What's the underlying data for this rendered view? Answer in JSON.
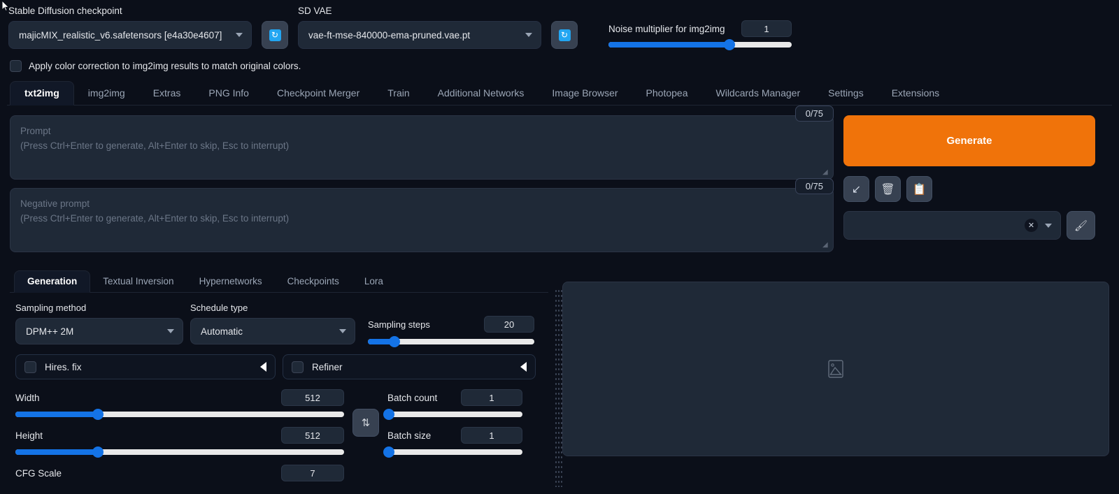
{
  "quicksettings": {
    "checkpoint": {
      "label": "Stable Diffusion checkpoint",
      "value": "majicMIX_realistic_v6.safetensors [e4a30e4607]"
    },
    "vae": {
      "label": "SD VAE",
      "value": "vae-ft-mse-840000-ema-pruned.vae.pt"
    },
    "refresh_icon": "refresh-icon",
    "noise_multiplier": {
      "label": "Noise multiplier for img2img",
      "value": "1",
      "fill_percent": 66
    },
    "color_correction": {
      "label": "Apply color correction to img2img results to match original colors.",
      "checked": false
    }
  },
  "main_tabs": {
    "active": "txt2img",
    "items": [
      "txt2img",
      "img2img",
      "Extras",
      "PNG Info",
      "Checkpoint Merger",
      "Train",
      "Additional Networks",
      "Image Browser",
      "Photopea",
      "Wildcards Manager",
      "Settings",
      "Extensions"
    ]
  },
  "prompt": {
    "positive": {
      "line1": "Prompt",
      "line2": "(Press Ctrl+Enter to generate, Alt+Enter to skip, Esc to interrupt)",
      "value": "",
      "token_counter": "0/75"
    },
    "negative": {
      "line1": "Negative prompt",
      "line2": "(Press Ctrl+Enter to generate, Alt+Enter to skip, Esc to interrupt)",
      "value": "",
      "token_counter": "0/75"
    }
  },
  "actions": {
    "generate_label": "Generate",
    "generate_color": "#f0730a",
    "tools": [
      {
        "name": "restore-progress-icon",
        "glyph": "↙"
      },
      {
        "name": "clear-prompt-icon",
        "glyph": "🗑"
      },
      {
        "name": "paste-styles-icon",
        "glyph": "📋"
      }
    ],
    "styles": {
      "value": "",
      "clear_icon": "close-icon",
      "dropdown_icon": "chevron-down-icon"
    },
    "edit_styles_icon": "paintbrush-icon"
  },
  "sub_tabs": {
    "active": "Generation",
    "items": [
      "Generation",
      "Textual Inversion",
      "Hypernetworks",
      "Checkpoints",
      "Lora"
    ]
  },
  "generation": {
    "sampling_method": {
      "label": "Sampling method",
      "value": "DPM++ 2M"
    },
    "schedule_type": {
      "label": "Schedule type",
      "value": "Automatic"
    },
    "sampling_steps": {
      "label": "Sampling steps",
      "value": "20",
      "fill_percent": 16
    },
    "hires_fix": {
      "label": "Hires. fix",
      "checked": false
    },
    "refiner": {
      "label": "Refiner",
      "checked": false
    },
    "width": {
      "label": "Width",
      "value": "512",
      "fill_percent": 25
    },
    "height": {
      "label": "Height",
      "value": "512",
      "fill_percent": 25
    },
    "swap_icon": "swap-dimensions-icon",
    "batch_count": {
      "label": "Batch count",
      "value": "1",
      "fill_percent": 1
    },
    "batch_size": {
      "label": "Batch size",
      "value": "1",
      "fill_percent": 1
    },
    "cfg_scale": {
      "label": "CFG Scale",
      "value": "7"
    }
  },
  "gallery": {
    "placeholder_icon": "image-placeholder-icon"
  },
  "theme": {
    "background": "#0b0f19",
    "panel": "#1f2937",
    "accent_blue": "#1473e6",
    "accent_orange": "#f0730a"
  }
}
